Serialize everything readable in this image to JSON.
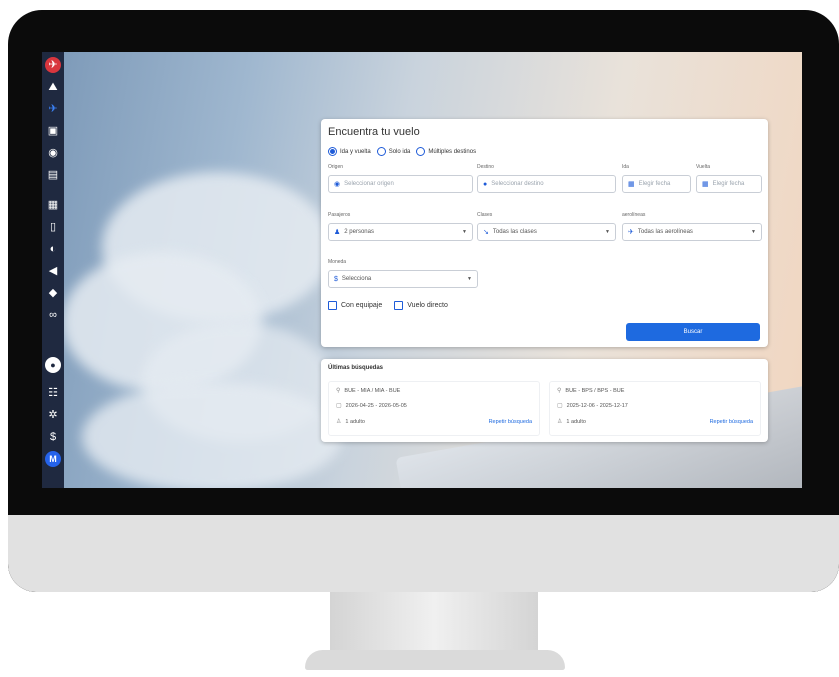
{
  "sidebar": {
    "items": [
      {
        "icon": "logo-icon"
      },
      {
        "icon": "hotel-icon"
      },
      {
        "icon": "plane-icon"
      },
      {
        "icon": "car-icon"
      },
      {
        "icon": "camera-icon"
      },
      {
        "icon": "ticket-icon"
      },
      {
        "icon": "grid-icon"
      },
      {
        "icon": "document-icon"
      },
      {
        "icon": "pie-chart-icon"
      },
      {
        "icon": "megaphone-icon"
      },
      {
        "icon": "tag-icon"
      },
      {
        "icon": "link-icon"
      },
      {
        "icon": "notification-icon"
      },
      {
        "icon": "users-icon"
      },
      {
        "icon": "settings-icon"
      },
      {
        "icon": "currency-icon"
      },
      {
        "icon": "avatar-icon",
        "text": "M"
      }
    ]
  },
  "search": {
    "title": "Encuentra tu vuelo",
    "trip_types": [
      "Ida y vuelta",
      "Solo ida",
      "Múltiples destinos"
    ],
    "labels": {
      "origin": "Origen",
      "destination": "Destino",
      "departure": "Ida",
      "return": "Vuelta",
      "passengers": "Pasajeros",
      "classes": "Clases",
      "airlines": "aerolíneas",
      "currency": "Moneda"
    },
    "placeholders": {
      "origin": "Seleccionar origen",
      "destination": "Seleccionar destino",
      "departure": "Elegir fecha",
      "return": "Elegir fecha"
    },
    "values": {
      "passengers": "2 personas",
      "classes": "Todas las clases",
      "airlines": "Todas las aerolíneas",
      "currency": "Selecciona"
    },
    "checks": [
      "Con equipaje",
      "Vuelo directo"
    ],
    "button": "Buscar"
  },
  "recent": {
    "title": "Últimas búsquedas",
    "items": [
      {
        "route": "BUE - MIA / MIA - BUE",
        "dates": "2026-04-25 - 2026-05-05",
        "pax": "1 adulto",
        "action": "Repetir búsqueda"
      },
      {
        "route": "BUE - BPS / BPS - BUE",
        "dates": "2025-12-06 - 2025-12-17",
        "pax": "1 adulto",
        "action": "Repetir búsqueda"
      }
    ]
  },
  "colors": {
    "accent": "#1e6ae0",
    "sidebar": "#1f2940",
    "logo": "#d9363e"
  }
}
